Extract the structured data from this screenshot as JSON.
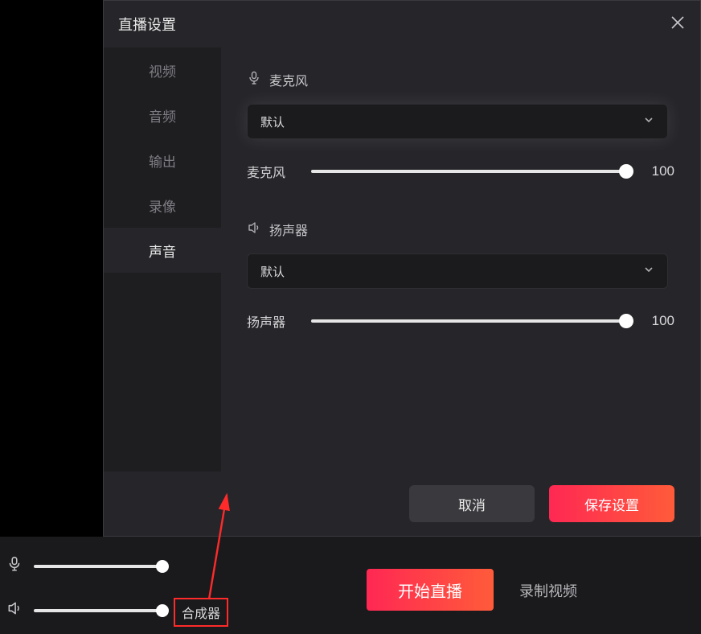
{
  "modal": {
    "title": "直播设置",
    "tabs": [
      {
        "label": "视频"
      },
      {
        "label": "音频"
      },
      {
        "label": "输出"
      },
      {
        "label": "录像"
      },
      {
        "label": "声音"
      }
    ],
    "sections": {
      "mic": {
        "title": "麦克风",
        "select": "默认",
        "slider_label": "麦克风",
        "value": "100"
      },
      "speaker": {
        "title": "扬声器",
        "select": "默认",
        "slider_label": "扬声器",
        "value": "100"
      }
    },
    "footer": {
      "cancel": "取消",
      "save": "保存设置"
    }
  },
  "bottom": {
    "synth_label": "合成器",
    "start": "开始直播",
    "record": "录制视频"
  }
}
